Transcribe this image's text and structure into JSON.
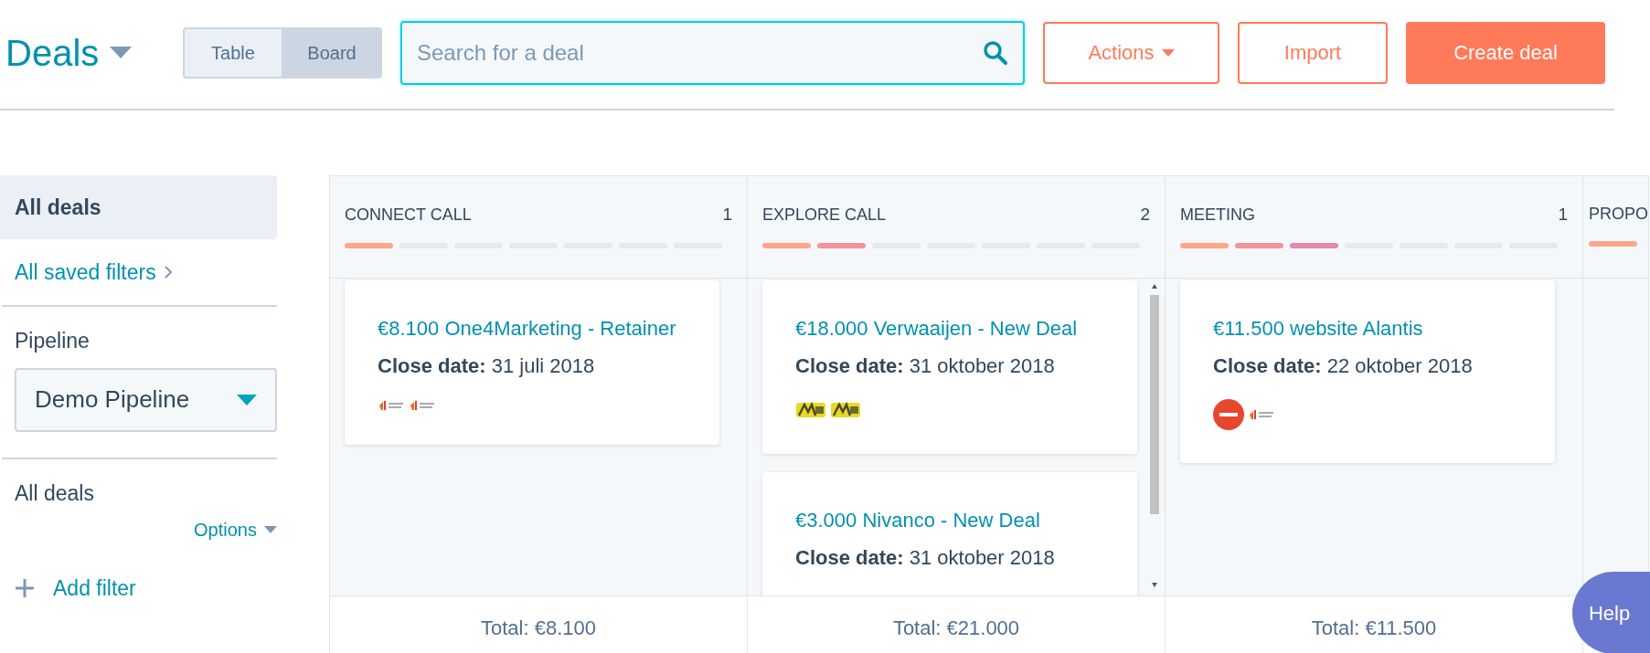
{
  "header": {
    "title": "Deals",
    "view_toggle": [
      {
        "label": "Table",
        "selected": false
      },
      {
        "label": "Board",
        "selected": true
      }
    ],
    "search": {
      "placeholder": "Search for a deal"
    },
    "buttons": [
      {
        "label": "Actions",
        "kind": "dropdown"
      },
      {
        "label": "Import",
        "kind": "outline"
      },
      {
        "label": "Create deal",
        "kind": "primary"
      }
    ]
  },
  "sidebar": {
    "views": [
      {
        "label": "All deals",
        "selected": true
      }
    ],
    "saved_filters_link": "All saved filters",
    "pipeline_label": "Pipeline",
    "pipeline_value": "Demo Pipeline",
    "filter_title": "All deals",
    "options_label": "Options",
    "add_filter": "Add filter"
  },
  "columns": [
    {
      "title": "CONNECT CALL",
      "count": "1",
      "filled_segments": [
        {
          "color": "#ffa58c"
        }
      ],
      "total": "Total: €8.100",
      "cards": [
        {
          "title": "€8.100 One4Marketing - Retainer",
          "close_label": "Close date:",
          "close_date": "31 juli 2018",
          "logos": [
            {
              "kind": "brand"
            },
            {
              "kind": "brand"
            }
          ]
        }
      ],
      "scrollbar": false
    },
    {
      "title": "EXPLORE CALL",
      "count": "2",
      "filled_segments": [
        {
          "color": "#ffa58c"
        },
        {
          "color": "#f2949c"
        }
      ],
      "total": "Total: €21.000",
      "cards": [
        {
          "title": "€18.000 Verwaaijen - New Deal",
          "close_label": "Close date:",
          "close_date": "31 oktober 2018",
          "logos": [
            {
              "kind": "yellow"
            },
            {
              "kind": "yellow"
            }
          ]
        },
        {
          "title": "€3.000 Nivanco - New Deal",
          "close_label": "Close date:",
          "close_date": "31 oktober 2018"
        }
      ],
      "scrollbar": true
    },
    {
      "title": "MEETING",
      "count": "1",
      "filled_segments": [
        {
          "color": "#ffa58c"
        },
        {
          "color": "#f2949c"
        },
        {
          "color": "#e38aae"
        }
      ],
      "total": "Total: €11.500",
      "cards": [
        {
          "title": "€11.500 website Alantis",
          "close_label": "Close date:",
          "close_date": "22 oktober 2018",
          "logos": [
            {
              "kind": "circle"
            },
            {
              "kind": "brand"
            }
          ]
        }
      ],
      "scrollbar": false
    },
    {
      "title": "PROPO",
      "filled_segments": [
        {
          "color": "#ffa58c"
        }
      ],
      "scrollbar": false
    }
  ],
  "help": "Help"
}
